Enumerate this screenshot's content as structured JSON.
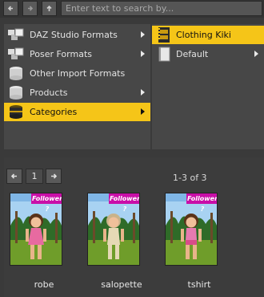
{
  "search": {
    "placeholder": "Enter text to search by..."
  },
  "categories": [
    {
      "label": "DAZ Studio Formats",
      "icon": "format-icon",
      "has_submenu": true,
      "selected": false
    },
    {
      "label": "Poser Formats",
      "icon": "format-icon",
      "has_submenu": true,
      "selected": false
    },
    {
      "label": "Other Import Formats",
      "icon": "import-icon",
      "has_submenu": false,
      "selected": false
    },
    {
      "label": "Products",
      "icon": "products-icon",
      "has_submenu": true,
      "selected": false
    },
    {
      "label": "Categories",
      "icon": "categories-icon",
      "has_submenu": true,
      "selected": true
    }
  ],
  "subcategories": [
    {
      "label": "Clothing Kiki",
      "icon": "film-icon",
      "has_submenu": false,
      "selected": true
    },
    {
      "label": "Default",
      "icon": "document-icon",
      "has_submenu": true,
      "selected": false
    }
  ],
  "pager": {
    "page": "1",
    "range": "1-3 of 3"
  },
  "thumbnails": [
    {
      "label": "robe",
      "badge": "Follower ?"
    },
    {
      "label": "salopette",
      "badge": "Follower ?"
    },
    {
      "label": "tshirt",
      "badge": "Follower ?"
    }
  ],
  "colors": {
    "selected": "#f5c518",
    "badge": "#c90fa8",
    "panel": "#474747"
  }
}
